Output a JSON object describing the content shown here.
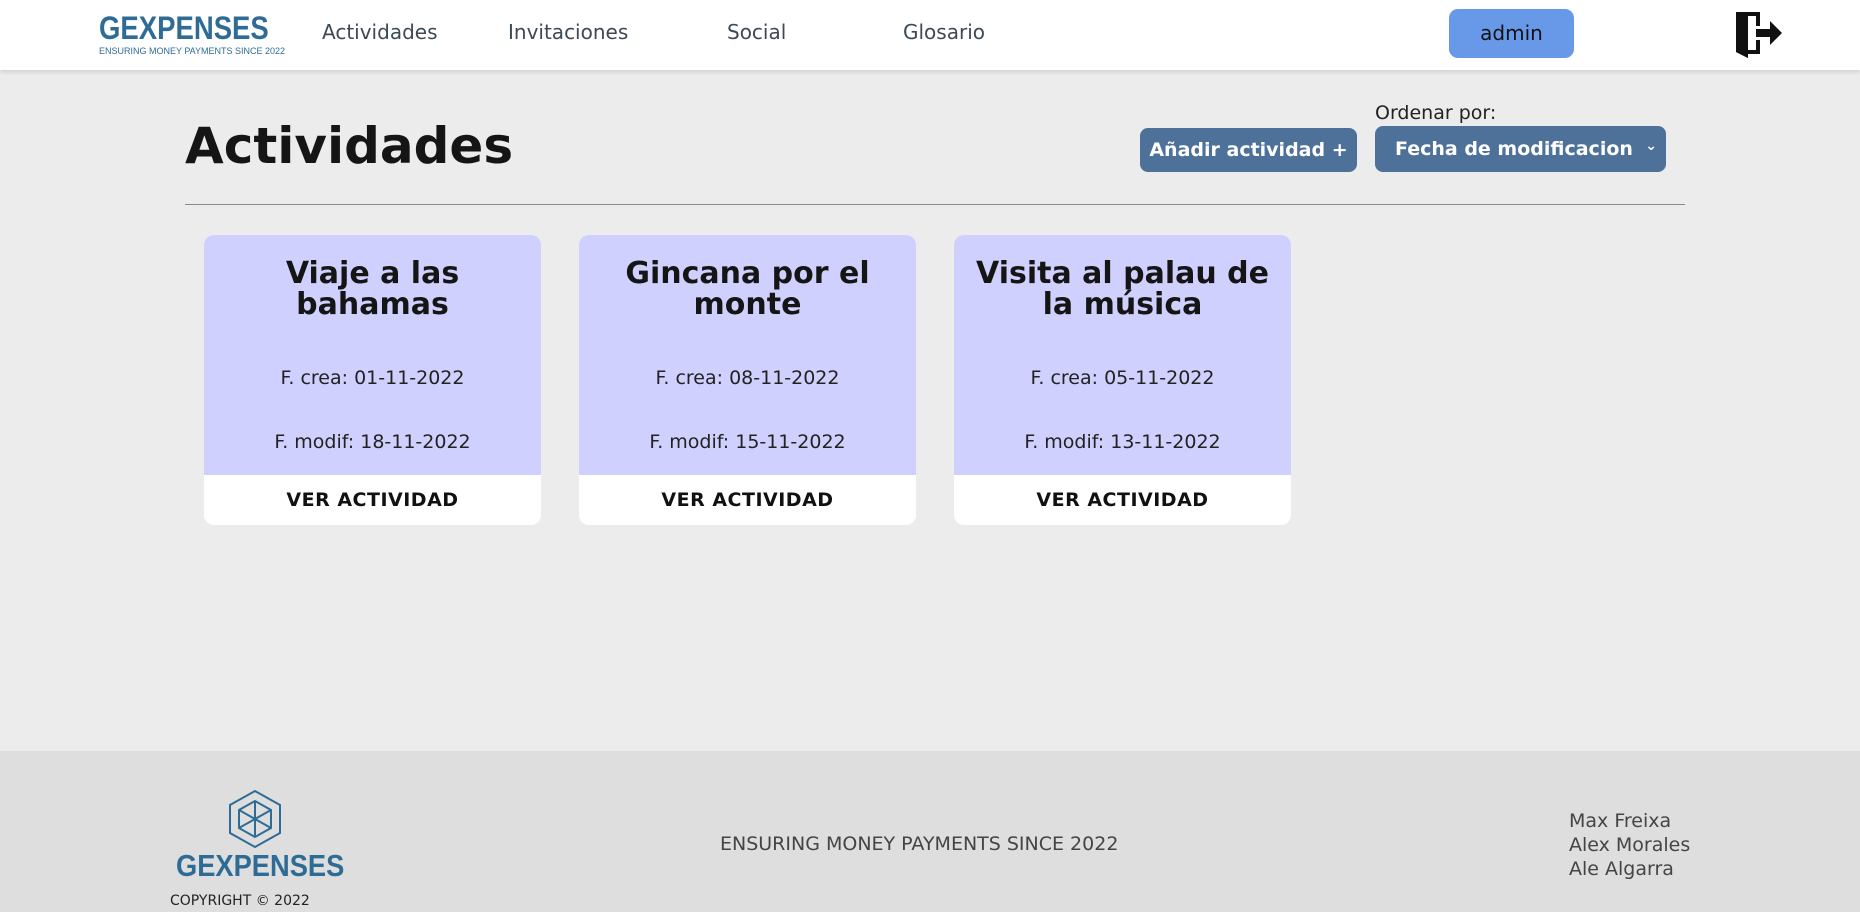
{
  "header": {
    "logo_text": "GEXPENSES",
    "logo_tagline": "ENSURING MONEY PAYMENTS SINCE 2022",
    "nav": [
      {
        "label": "Actividades"
      },
      {
        "label": "Invitaciones"
      },
      {
        "label": "Social"
      },
      {
        "label": "Glosario"
      }
    ],
    "user_label": "admin",
    "logout_icon": "logout-door-icon"
  },
  "main": {
    "title": "Actividades",
    "add_button_label": "Añadir actividad +",
    "sort": {
      "label": "Ordenar por:",
      "selected": "Fecha de modificacion"
    },
    "cards": [
      {
        "title": "Viaje a las bahamas",
        "created": "F. crea: 01-11-2022",
        "modified": "F. modif: 18-11-2022",
        "link": "VER ACTIVIDAD"
      },
      {
        "title": "Gincana por el monte",
        "created": "F. crea: 08-11-2022",
        "modified": "F. modif: 15-11-2022",
        "link": "VER ACTIVIDAD"
      },
      {
        "title": "Visita al palau de la música",
        "created": "F. crea: 05-11-2022",
        "modified": "F. modif: 13-11-2022",
        "link": "VER ACTIVIDAD"
      }
    ]
  },
  "footer": {
    "logo_text": "GEXPENSES",
    "copyright": "COPYRIGHT © 2022",
    "slogan": "ENSURING MONEY PAYMENTS SINCE 2022",
    "authors": [
      "Max Freixa",
      "Alex Morales",
      "Ale Algarra"
    ]
  },
  "colors": {
    "brand": "#2e6c96",
    "primary_button": "#4e719a",
    "user_button": "#6899e8",
    "card_bg": "#d0d0fe",
    "page_bg": "#ececec",
    "footer_bg": "#dedede"
  }
}
